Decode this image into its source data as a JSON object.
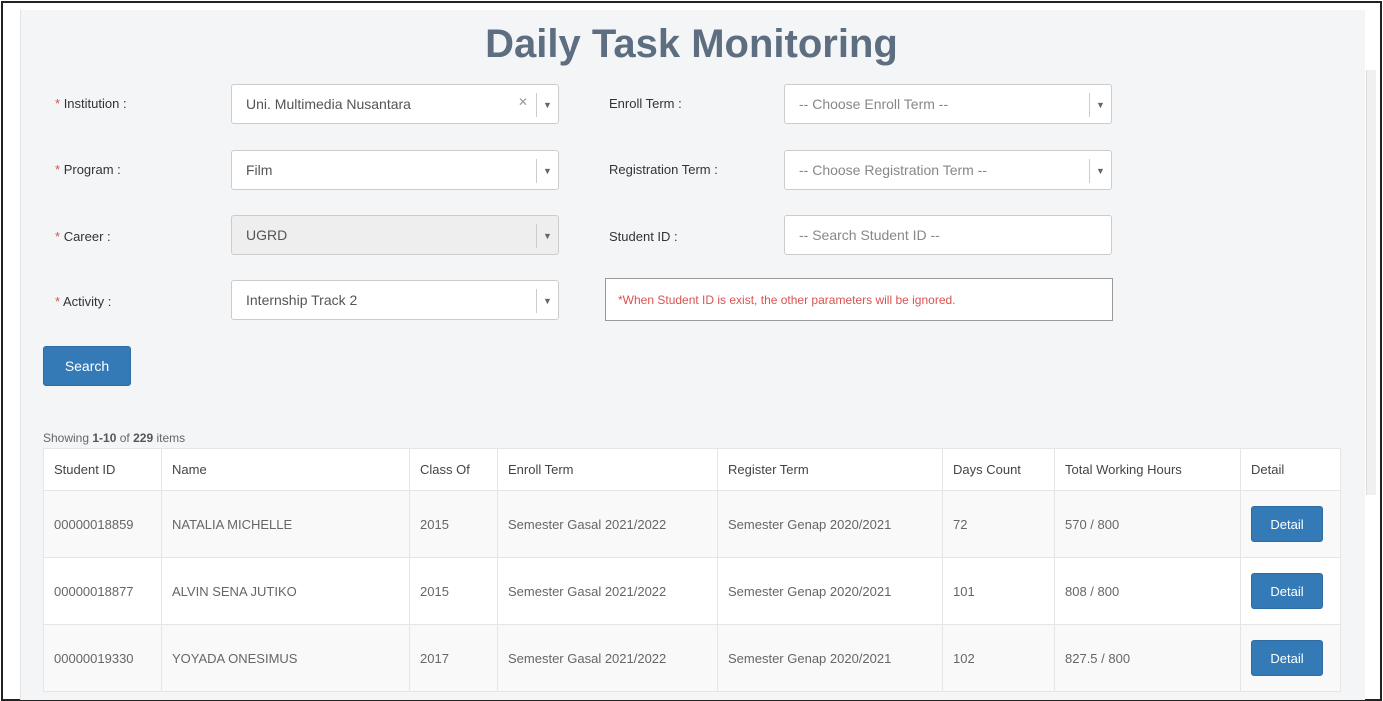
{
  "title": "Daily Task Monitoring",
  "filters": {
    "institution": {
      "label": "Institution :",
      "required": "*",
      "value": "Uni. Multimedia Nusantara"
    },
    "program": {
      "label": "Program :",
      "required": "*",
      "value": "Film"
    },
    "career": {
      "label": "Career :",
      "required": "*",
      "value": "UGRD"
    },
    "activity": {
      "label": "Activity :",
      "required": "*",
      "value": "Internship Track 2"
    },
    "enroll_term": {
      "label": "Enroll Term :",
      "placeholder": "-- Choose Enroll Term --"
    },
    "registration_term": {
      "label": "Registration Term :",
      "placeholder": "-- Choose Registration Term --"
    },
    "student_id": {
      "label": "Student ID :",
      "placeholder": "-- Search Student ID --"
    },
    "warning": "*When Student ID is exist, the other parameters will be ignored."
  },
  "search_label": "Search",
  "summary": {
    "prefix": "Showing",
    "range": "1-10",
    "of": "of",
    "total": "229",
    "suffix": "items"
  },
  "table": {
    "columns": [
      "Student ID",
      "Name",
      "Class Of",
      "Enroll Term",
      "Register Term",
      "Days Count",
      "Total Working Hours",
      "Detail"
    ],
    "rows": [
      {
        "student_id": "00000018859",
        "name": "NATALIA MICHELLE",
        "class_of": "2015",
        "enroll_term": "Semester Gasal 2021/2022",
        "register_term": "Semester Genap 2020/2021",
        "days_count": "72",
        "hours": "570 / 800",
        "detail": "Detail"
      },
      {
        "student_id": "00000018877",
        "name": "ALVIN SENA JUTIKO",
        "class_of": "2015",
        "enroll_term": "Semester Gasal 2021/2022",
        "register_term": "Semester Genap 2020/2021",
        "days_count": "101",
        "hours": "808 / 800",
        "detail": "Detail"
      },
      {
        "student_id": "00000019330",
        "name": "YOYADA ONESIMUS",
        "class_of": "2017",
        "enroll_term": "Semester Gasal 2021/2022",
        "register_term": "Semester Genap 2020/2021",
        "days_count": "102",
        "hours": "827.5 / 800",
        "detail": "Detail"
      }
    ]
  }
}
